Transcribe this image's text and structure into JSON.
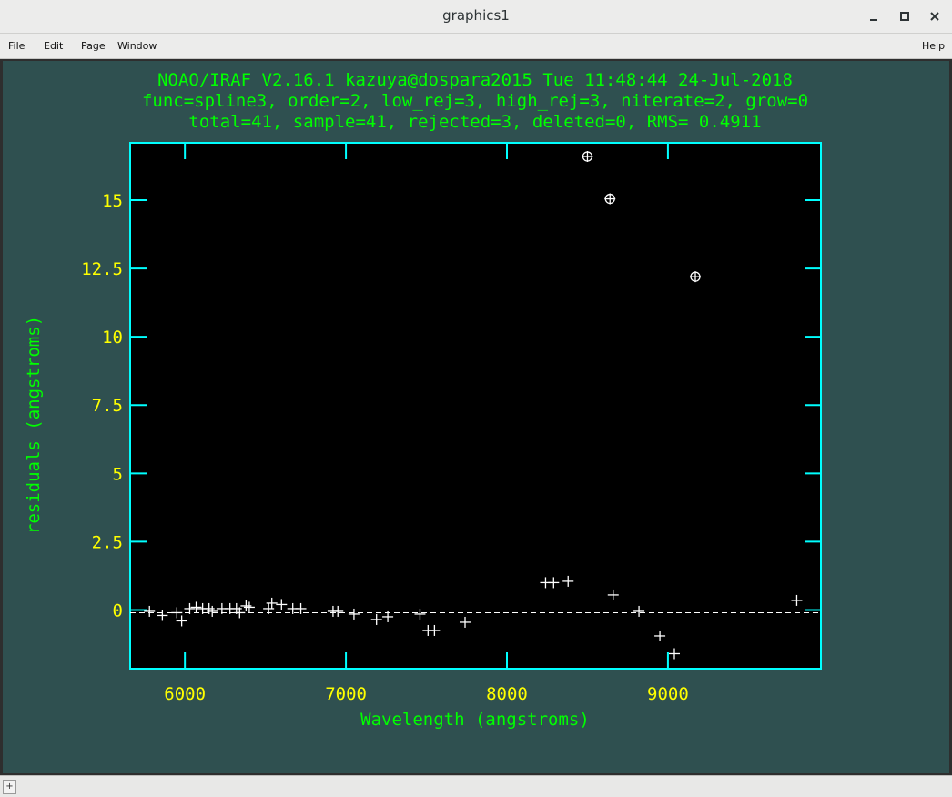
{
  "window": {
    "title": "graphics1",
    "controls": {
      "minimize": "minimize-icon",
      "maximize": "maximize-icon",
      "close": "close-icon"
    }
  },
  "menu": {
    "file": "File",
    "edit": "Edit",
    "page": "Page",
    "window": "Window",
    "help": "Help"
  },
  "plot": {
    "header": [
      "NOAO/IRAF V2.16.1 kazuya@dospara2015 Tue 11:48:44 24-Jul-2018",
      "func=spline3, order=2, low_rej=3, high_rej=3, niterate=2, grow=0",
      "total=41, sample=41, rejected=3, deleted=0, RMS= 0.4911"
    ],
    "colors": {
      "background": "#000000",
      "frame": "#00ffff",
      "text": "#00ff00",
      "ticks": "#ffff00",
      "points": "#ffffff"
    }
  },
  "chart_data": {
    "type": "scatter",
    "title": "NOAO/IRAF V2.16.1 kazuya@dospara2015 Tue 11:48:44 24-Jul-2018",
    "subtitle": "func=spline3, order=2, low_rej=3, high_rej=3, niterate=2, grow=0 | total=41, sample=41, rejected=3, deleted=0, RMS= 0.4911",
    "xlabel": "Wavelength (angstroms)",
    "ylabel": "residuals (angstroms)",
    "xlim": [
      5660,
      9950
    ],
    "ylim": [
      -2.15,
      17.1
    ],
    "xticks": [
      "6000",
      "7000",
      "8000",
      "9000"
    ],
    "xtick_values": [
      6000,
      7000,
      8000,
      9000
    ],
    "yticks": [
      "0",
      "2.5",
      "5",
      "7.5",
      "10",
      "12.5",
      "15"
    ],
    "ytick_values": [
      0,
      2.5,
      5,
      7.5,
      10,
      12.5,
      15
    ],
    "grid": false,
    "fit_line_y": -0.1,
    "series": [
      {
        "name": "",
        "marker": "+",
        "x": [
          5780,
          5860,
          5950,
          5980,
          6030,
          6070,
          6110,
          6150,
          6170,
          6230,
          6280,
          6320,
          6340,
          6380,
          6400,
          6520,
          6540,
          6600,
          6670,
          6720,
          6920,
          6950,
          7050,
          7190,
          7260,
          7460,
          7510,
          7550,
          7740,
          8240,
          8290,
          8380,
          8660,
          8820,
          8950,
          9040,
          9800
        ],
        "y": [
          -0.05,
          -0.2,
          -0.1,
          -0.4,
          0.05,
          0.1,
          0.05,
          0.05,
          -0.05,
          0.05,
          0.05,
          0.05,
          -0.1,
          0.15,
          0.1,
          0.05,
          0.25,
          0.2,
          0.05,
          0.05,
          -0.05,
          -0.05,
          -0.15,
          -0.35,
          -0.25,
          -0.15,
          -0.75,
          -0.75,
          -0.45,
          1.0,
          1.0,
          1.05,
          0.55,
          -0.05,
          -0.95,
          -1.6,
          0.35
        ]
      },
      {
        "name": "",
        "marker": "circled-+",
        "x": [
          8500,
          8640,
          9170
        ],
        "y": [
          16.6,
          15.05,
          12.2
        ]
      }
    ]
  }
}
